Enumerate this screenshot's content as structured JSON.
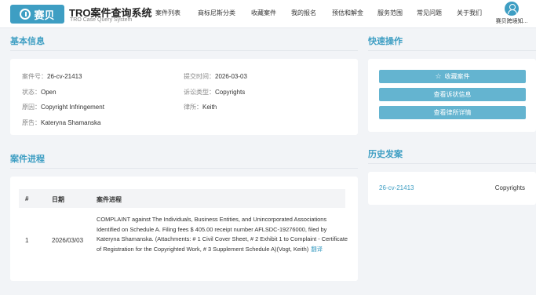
{
  "header": {
    "logo_text": "赛贝",
    "brand_title": "TRO案件查询系统",
    "brand_sub": "TRO Case Query System",
    "nav": [
      "案件列表",
      "商标尼斯分类",
      "收藏案件",
      "我的报名",
      "预估和解金",
      "服务范围",
      "常见问题",
      "关于我们"
    ],
    "user_name": "赛贝跨境知..."
  },
  "basic_info": {
    "title": "基本信息",
    "case_no_label": "案件号：",
    "case_no": "26-cv-21413",
    "submit_label": "提交时间：",
    "submit_time": "2026-03-03",
    "status_label": "状态：",
    "status": "Open",
    "lawsuit_type_label": "诉讼类型：",
    "lawsuit_type": "Copyrights",
    "cause_label": "原因：",
    "cause": "Copyright Infringement",
    "lawyer_label": "律所：",
    "lawyer": "Keith",
    "plaintiff_label": "原告：",
    "plaintiff": "Kateryna Shamanska"
  },
  "quick_actions": {
    "title": "快速操作",
    "buttons": [
      "收藏案件",
      "查看诉状信息",
      "查看律所详情"
    ]
  },
  "progress": {
    "title": "案件进程",
    "headers": [
      "#",
      "日期",
      "案件进程"
    ],
    "rows": [
      {
        "index": "1",
        "date": "2026/03/03",
        "text": "COMPLAINT against The Individuals, Business Entities, and Unincorporated Associations Identified on Schedule A. Filing fees $ 405.00 receipt number AFLSDC-19276000, filed by Kateryna Shamanska. (Attachments: # 1 Civil Cover Sheet, # 2 Exhibit 1 to Complaint - Certificate of Registration for the Copyrighted Work, # 3 Supplement Schedule A)(Vogt, Keith)",
        "translate": "翻译"
      }
    ]
  },
  "history": {
    "title": "历史发案",
    "items": [
      {
        "case_no": "26-cv-21413",
        "type": "Copyrights"
      }
    ]
  }
}
